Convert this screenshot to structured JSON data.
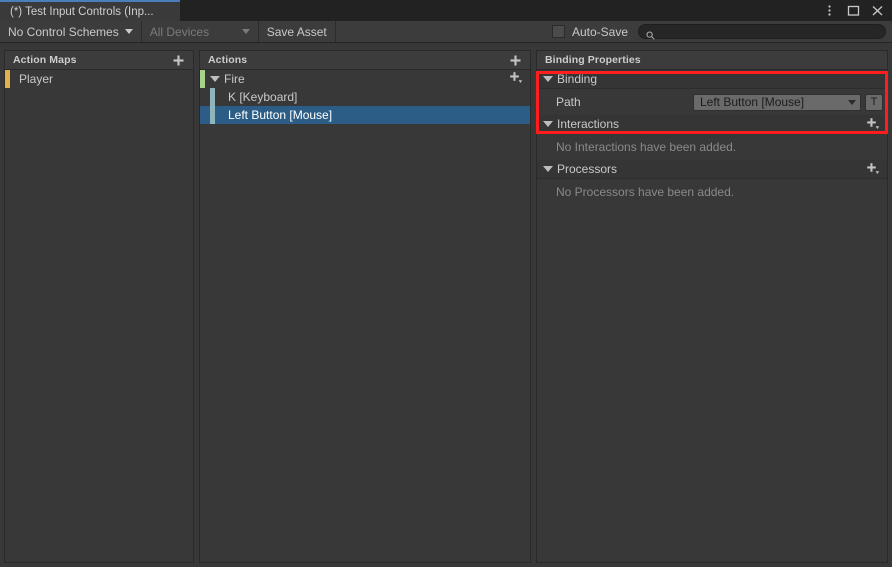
{
  "window": {
    "tab_title": "(*) Test Input Controls (Inp...",
    "controls": [
      {
        "name": "kebab-menu-icon",
        "label": "⋮"
      },
      {
        "name": "maximize-icon",
        "label": "□"
      },
      {
        "name": "close-icon",
        "label": "×"
      }
    ]
  },
  "toolbar": {
    "control_schemes_label": "No Control Schemes",
    "devices_label": "All Devices",
    "save_asset_label": "Save Asset",
    "autosave_label": "Auto-Save",
    "autosave_checked": false,
    "search_placeholder": "",
    "search_value": ""
  },
  "action_maps": {
    "header": "Action Maps",
    "add_label": "+",
    "items": [
      {
        "label": "Player",
        "accent": "#e3b04b",
        "selected": false
      }
    ]
  },
  "actions": {
    "header": "Actions",
    "add_label": "+",
    "items": [
      {
        "label": "Fire",
        "kind": "action",
        "accent": "#a8d08d",
        "expanded": true,
        "selected": false,
        "add_label": "+"
      },
      {
        "label": "K [Keyboard]",
        "kind": "binding",
        "accent": "#8fb4bc",
        "selected": false
      },
      {
        "label": "Left Button [Mouse]",
        "kind": "binding",
        "accent": "#8fb4bc",
        "selected": true
      }
    ]
  },
  "binding_properties": {
    "header": "Binding Properties",
    "sections": [
      {
        "id": "binding",
        "title": "Binding",
        "expanded": true,
        "has_add": false,
        "rows": [
          {
            "label": "Path",
            "value": "Left Button [Mouse]",
            "button_label": "T"
          }
        ]
      },
      {
        "id": "interactions",
        "title": "Interactions",
        "expanded": true,
        "has_add": true,
        "empty_text": "No Interactions have been added."
      },
      {
        "id": "processors",
        "title": "Processors",
        "expanded": true,
        "has_add": true,
        "empty_text": "No Processors have been added."
      }
    ]
  },
  "annotation": {
    "color": "#ff1d1d",
    "target": "binding-section"
  },
  "colors": {
    "selection_blue": "#2c5d87",
    "tab_accent": "#4a7ebb",
    "panel_bg": "#383838",
    "header_bg": "#3c3c3c"
  }
}
